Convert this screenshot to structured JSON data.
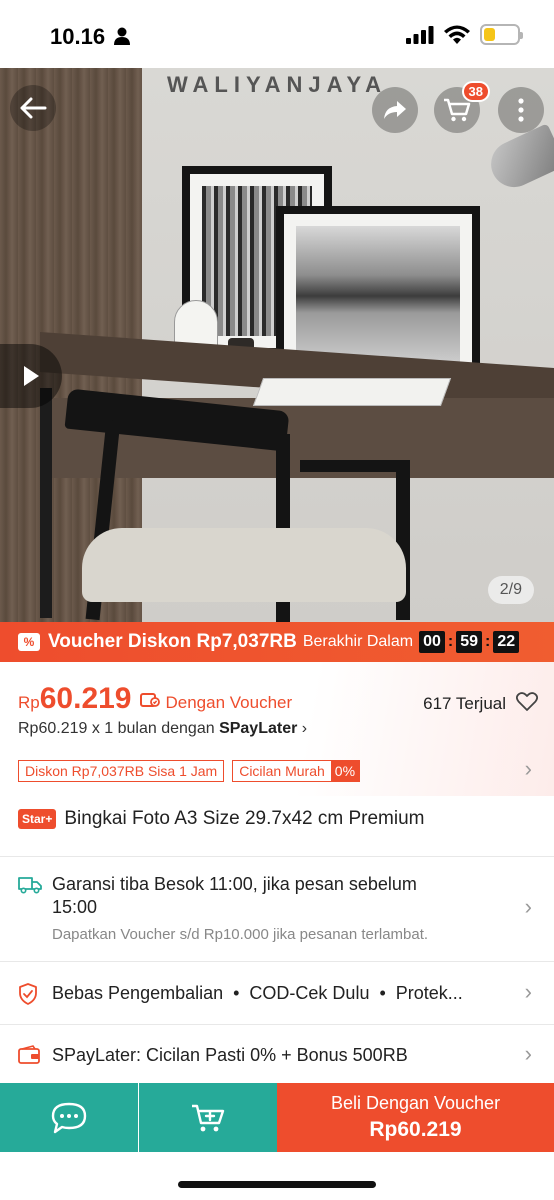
{
  "status": {
    "time": "10.16"
  },
  "header": {
    "shop_watermark": "WALIYANJAYA",
    "cart_count": "38"
  },
  "gallery": {
    "counter": "2/9"
  },
  "voucher": {
    "title": "Voucher Diskon Rp7,037RB",
    "ends_label": "Berakhir Dalam",
    "timer": {
      "h": "00",
      "m": "59",
      "s": "22"
    }
  },
  "price": {
    "currency": "Rp",
    "value": "60.219",
    "note": "Dengan Voucher",
    "sold": "617 Terjual",
    "installment_prefix": "Rp60.219 x 1 bulan dengan",
    "installment_brand": "SPayLater"
  },
  "tags": {
    "discount": "Diskon Rp7,037RB Sisa 1 Jam",
    "cicilan_label": "Cicilan Murah",
    "cicilan_value": "0%"
  },
  "product": {
    "badge": "Star+",
    "title": "Bingkai Foto A3 Size 29.7x42 cm Premium"
  },
  "shipping": {
    "line1": "Garansi tiba Besok 11:00, jika pesan sebelum",
    "line2": "15:00",
    "sub": "Dapatkan Voucher s/d Rp10.000 jika pesanan terlambat."
  },
  "guarantee": {
    "text": "Bebas Pengembalian  •  COD-Cek Dulu  •  Protek..."
  },
  "spaylater": {
    "text": "SPayLater: Cicilan Pasti 0% + Bonus 500RB"
  },
  "bottom_bar": {
    "buy_label": "Beli Dengan Voucher",
    "buy_price": "Rp60.219"
  },
  "colors": {
    "primary": "#ee4d2d",
    "teal": "#26aa99"
  },
  "icons": [
    "person-icon",
    "signal-icon",
    "wifi-icon",
    "battery-icon",
    "back-arrow-icon",
    "share-icon",
    "cart-icon",
    "more-icon",
    "play-icon",
    "voucher-icon",
    "heart-icon",
    "truck-icon",
    "shield-icon",
    "wallet-icon",
    "chat-icon",
    "add-to-cart-icon"
  ]
}
